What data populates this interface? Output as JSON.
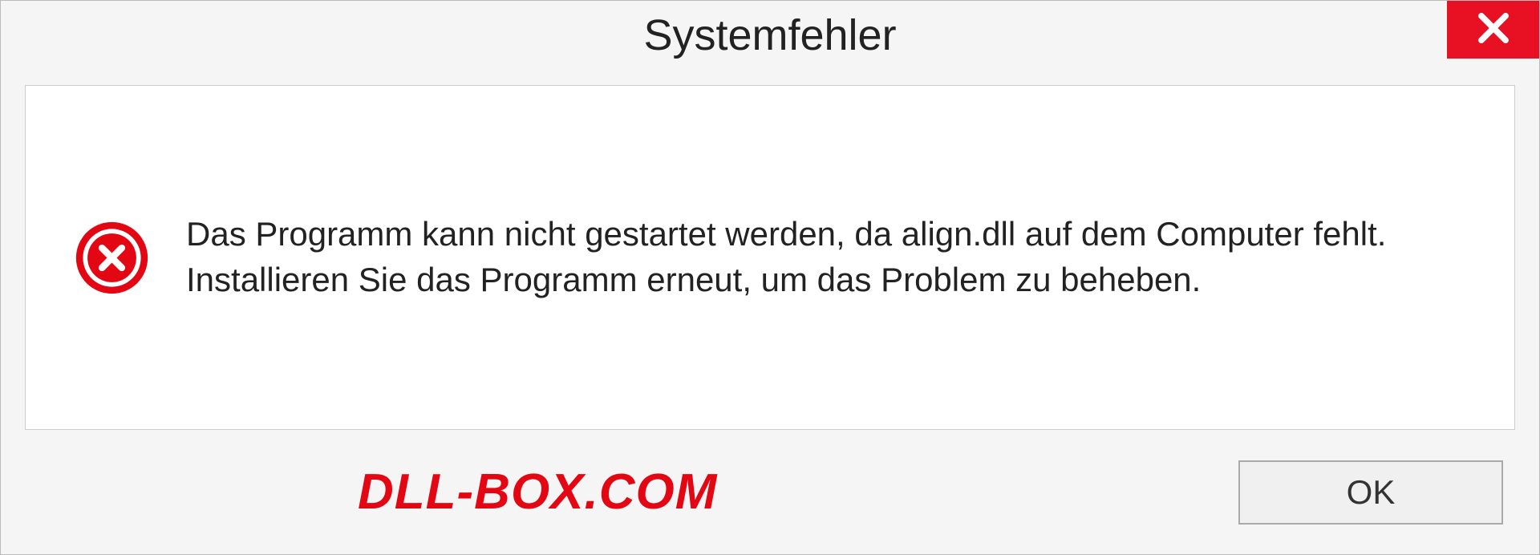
{
  "dialog": {
    "title": "Systemfehler",
    "message": "Das Programm kann nicht gestartet werden, da align.dll auf dem Computer fehlt. Installieren Sie das Programm erneut, um das Problem zu beheben.",
    "ok_label": "OK"
  },
  "watermark": "DLL-BOX.COM",
  "colors": {
    "close_bg": "#e81123",
    "error_icon": "#e30613",
    "watermark": "#e30613"
  }
}
